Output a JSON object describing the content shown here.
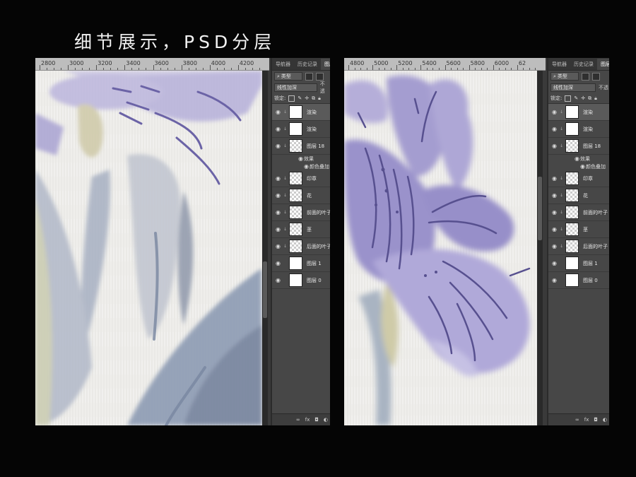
{
  "page": {
    "title": "细节展示，PSD分层"
  },
  "panels_common": {
    "tabs": [
      "导航器",
      "历史记录",
      "图层"
    ],
    "filter_kind": "类型",
    "blend_mode": "线性加深",
    "opacity_label": "不透",
    "lock_label": "锁定:",
    "layers": [
      {
        "name": "渲染",
        "thumb": "white",
        "clipped": true,
        "selected": true
      },
      {
        "name": "渲染",
        "thumb": "white",
        "clipped": true,
        "selected": false
      },
      {
        "name": "图层 18",
        "thumb": "transparent",
        "clipped": true,
        "selected": false
      },
      {
        "name": "印章",
        "thumb": "transparent",
        "clipped": true,
        "selected": false
      },
      {
        "name": "花",
        "thumb": "transparent",
        "clipped": true,
        "selected": false
      },
      {
        "name": "前面的叶子",
        "thumb": "transparent",
        "clipped": true,
        "selected": false
      },
      {
        "name": "茎",
        "thumb": "transparent",
        "clipped": true,
        "selected": false
      },
      {
        "name": "后面的叶子",
        "thumb": "transparent",
        "clipped": true,
        "selected": false
      },
      {
        "name": "图层 1",
        "thumb": "white",
        "clipped": false,
        "selected": false
      },
      {
        "name": "图层 0",
        "thumb": "white",
        "clipped": false,
        "selected": false
      }
    ],
    "effects_label": "效果",
    "effect_item": "颜色叠加",
    "footer_icons": [
      "link-icon",
      "fx-icon",
      "mask-icon",
      "adjustment-icon"
    ],
    "footer_labels": [
      "∞",
      "fx",
      "◘",
      "◐"
    ]
  },
  "left_shot": {
    "ruler_ticks": [
      "2800",
      "3000",
      "3200",
      "3400",
      "3600",
      "3800",
      "4000",
      "4200"
    ]
  },
  "right_shot": {
    "ruler_ticks": [
      "4800",
      "5000",
      "5200",
      "5400",
      "5600",
      "5800",
      "6000",
      "62"
    ]
  },
  "colors": {
    "background": "#050505",
    "panel": "#474747",
    "paper": "#eeedea",
    "iris_purple": "#8c86c4",
    "leaf_blue": "#8e9bb3"
  }
}
